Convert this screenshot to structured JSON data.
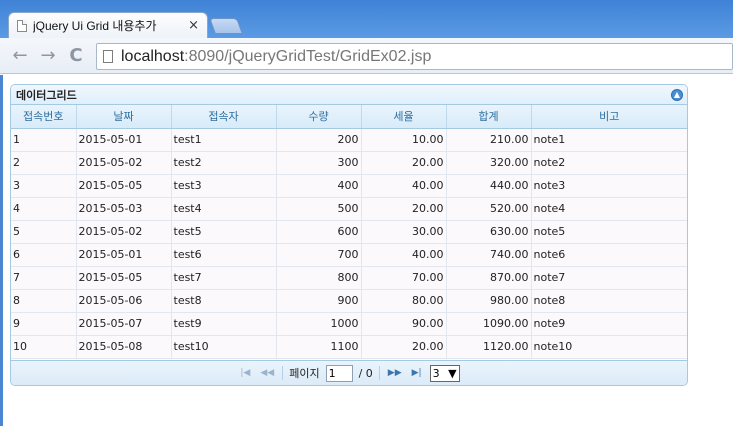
{
  "browser": {
    "tab_title": "jQuery Ui Grid 내용추가",
    "tab_close": "×",
    "url_host": "localhost",
    "url_rest": ":8090/jQueryGridTest/GridEx02.jsp",
    "back_glyph": "←",
    "forward_glyph": "→",
    "reload_glyph": "C"
  },
  "grid": {
    "caption": "데이터그리드",
    "collapse_glyph": "▲",
    "columns": [
      "접속번호",
      "날짜",
      "접속자",
      "수량",
      "세율",
      "합계",
      "비고"
    ],
    "rows": [
      [
        "1",
        "2015-05-01",
        "test1",
        "200",
        "10.00",
        "210.00",
        "note1"
      ],
      [
        "2",
        "2015-05-02",
        "test2",
        "300",
        "20.00",
        "320.00",
        "note2"
      ],
      [
        "3",
        "2015-05-05",
        "test3",
        "400",
        "40.00",
        "440.00",
        "note3"
      ],
      [
        "4",
        "2015-05-03",
        "test4",
        "500",
        "20.00",
        "520.00",
        "note4"
      ],
      [
        "5",
        "2015-05-02",
        "test5",
        "600",
        "30.00",
        "630.00",
        "note5"
      ],
      [
        "6",
        "2015-05-01",
        "test6",
        "700",
        "40.00",
        "740.00",
        "note6"
      ],
      [
        "7",
        "2015-05-05",
        "test7",
        "800",
        "70.00",
        "870.00",
        "note7"
      ],
      [
        "8",
        "2015-05-06",
        "test8",
        "900",
        "80.00",
        "980.00",
        "note8"
      ],
      [
        "9",
        "2015-05-07",
        "test9",
        "1000",
        "90.00",
        "1090.00",
        "note9"
      ],
      [
        "10",
        "2015-05-08",
        "test10",
        "1100",
        "20.00",
        "1120.00",
        "note10"
      ]
    ]
  },
  "pager": {
    "first_icon": "|◀",
    "prev_icon": "◀◀",
    "page_label": "페이지",
    "page_value": "1",
    "of_label": "/ 0",
    "next_icon": "▶▶",
    "last_icon": "▶|",
    "rows_selected": "3",
    "rows_arrow": "▼"
  },
  "colors": {
    "header_text": "#2e6e9e",
    "border": "#a6c9e2",
    "titlebar": "#3f82d6"
  }
}
